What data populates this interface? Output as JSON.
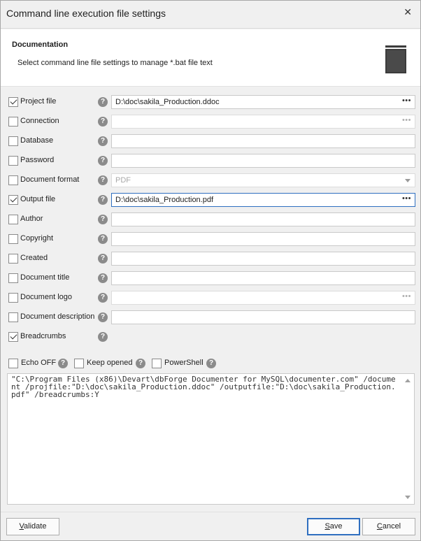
{
  "window": {
    "title": "Command line execution file settings",
    "close_glyph": "✕"
  },
  "header": {
    "title": "Documentation",
    "subtitle": "Select command line file settings to manage *.bat file text",
    "icon": "book-icon"
  },
  "help_glyph": "?",
  "ellipsis_glyph": "•••",
  "fields": [
    {
      "label": "Project file",
      "checked": true,
      "value": "D:\\doc\\sakila_Production.ddoc",
      "has_browse": true,
      "enabled": true
    },
    {
      "label": "Connection",
      "checked": false,
      "value": "",
      "has_browse": true,
      "enabled": false
    },
    {
      "label": "Database",
      "checked": false,
      "value": "",
      "enabled": true
    },
    {
      "label": "Password",
      "checked": false,
      "value": "",
      "enabled": true
    },
    {
      "label": "Document format",
      "checked": false,
      "value": "PDF",
      "is_dropdown": true,
      "enabled": false
    },
    {
      "label": "Output file",
      "checked": true,
      "value": "D:\\doc\\sakila_Production.pdf",
      "has_browse": true,
      "enabled": true,
      "focused": true
    },
    {
      "label": "Author",
      "checked": false,
      "value": "",
      "enabled": true
    },
    {
      "label": "Copyright",
      "checked": false,
      "value": "",
      "enabled": true
    },
    {
      "label": "Created",
      "checked": false,
      "value": "",
      "enabled": true
    },
    {
      "label": "Document title",
      "checked": false,
      "value": "",
      "enabled": true
    },
    {
      "label": "Document logo",
      "checked": false,
      "value": "",
      "has_browse": true,
      "enabled": false
    },
    {
      "label": "Document description",
      "checked": false,
      "value": "",
      "enabled": true
    },
    {
      "label": "Breadcrumbs",
      "checked": true
    }
  ],
  "options": {
    "echo_off": {
      "label": "Echo OFF",
      "checked": false
    },
    "keep_opened": {
      "label": "Keep opened",
      "checked": false
    },
    "powershell": {
      "label": "PowerShell",
      "checked": false
    }
  },
  "command_text": "\"C:\\Program Files (x86)\\Devart\\dbForge Documenter for MySQL\\documenter.com\" /document /projfile:\"D:\\doc\\sakila_Production.ddoc\" /outputfile:\"D:\\doc\\sakila_Production.pdf\" /breadcrumbs:Y",
  "buttons": {
    "validate": "Validate",
    "save": "Save",
    "cancel": "Cancel"
  },
  "colors": {
    "accent": "#2f6fc0",
    "help_icon": "#8b8b8b"
  }
}
